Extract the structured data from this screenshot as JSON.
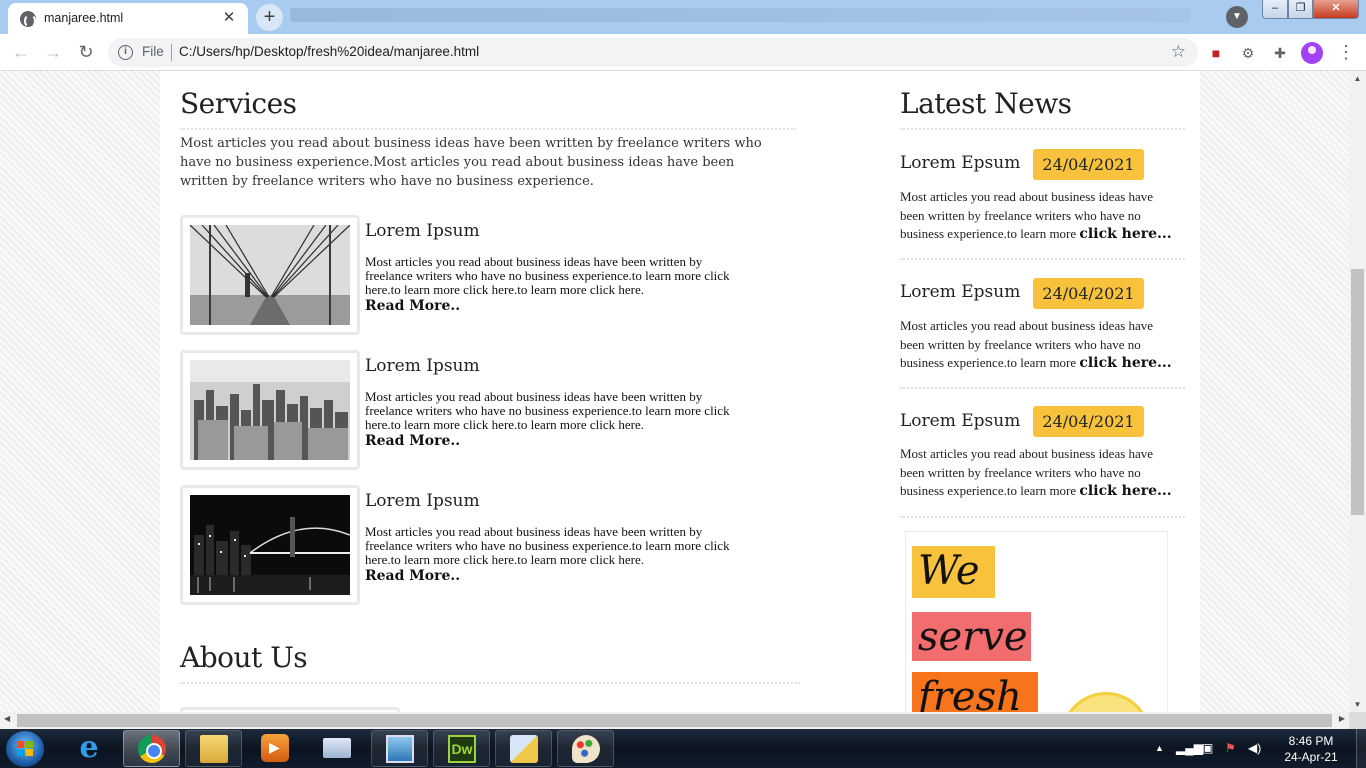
{
  "browser": {
    "tab_title": "manjaree.html",
    "tab_close": "✕",
    "new_tab": "+",
    "scheme_label": "File",
    "url": "C:/Users/hp/Desktop/fresh%20idea/manjaree.html"
  },
  "page": {
    "services": {
      "heading": "Services",
      "intro": "Most articles you read about business ideas have been written by freelance writers who have no business experience.Most articles you read about business ideas have been written by freelance writers who have no business experience.",
      "items": [
        {
          "title": "Lorem Ipsum",
          "text": "Most articles you read about business ideas have been written by freelance writers who have no business experience.to learn more click here.to learn more click here.to learn more click here.",
          "more": "Read More.."
        },
        {
          "title": "Lorem Ipsum",
          "text": "Most articles you read about business ideas have been written by freelance writers who have no business experience.to learn more click here.to learn more click here.to learn more click here.",
          "more": "Read More.."
        },
        {
          "title": "Lorem Ipsum",
          "text": "Most articles you read about business ideas have been written by freelance writers who have no business experience.to learn more click here.to learn more click here.to learn more click here.",
          "more": "Read More.."
        }
      ]
    },
    "about": {
      "heading": "About Us"
    },
    "news": {
      "heading": "Latest News",
      "items": [
        {
          "title": "Lorem Epsum",
          "date": "24/04/2021",
          "text": "Most articles you read about business ideas have been written by freelance writers who have no business experience.to learn more",
          "link": "click here..."
        },
        {
          "title": "Lorem Epsum",
          "date": "24/04/2021",
          "text": "Most articles you read about business ideas have been written by freelance writers who have no business experience.to learn more",
          "link": "click here..."
        },
        {
          "title": "Lorem Epsum",
          "date": "24/04/2021",
          "text": "Most articles you read about business ideas have been written by freelance writers who have no business experience.to learn more",
          "link": "click here..."
        }
      ]
    },
    "promo": {
      "words": [
        "We",
        "serve",
        "fresh"
      ],
      "colors": [
        "#f9c23c",
        "#f26d6d",
        "#f7741c"
      ]
    }
  },
  "taskbar": {
    "clock_time": "8:46 PM",
    "clock_date": "24-Apr-21",
    "dw_label": "Dw"
  },
  "colors": {
    "date_badge": "#f9c23c",
    "tab_strip": "#a9cbef"
  }
}
